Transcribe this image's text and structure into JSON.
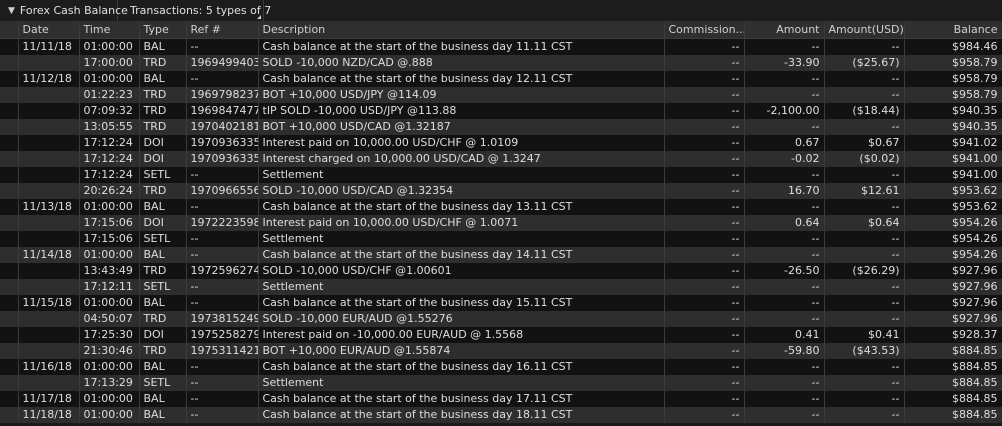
{
  "toolbar": {
    "chevron_icon": "chevron-down-icon",
    "title": "Forex Cash Balance",
    "filter_label": "Transactions: 5 types of 7"
  },
  "columns": [
    "Date",
    "Time",
    "Type",
    "Ref #",
    "Description",
    "Commission...",
    "Amount",
    "Amount(USD)",
    "Balance"
  ],
  "rows": [
    [
      "11/11/18",
      "01:00:00",
      "BAL",
      "--",
      "Cash balance at the start of the business day 11.11 CST",
      "--",
      "--",
      "--",
      "$984.46"
    ],
    [
      "",
      "17:00:00",
      "TRD",
      "1969499403",
      "SOLD -10,000 NZD/CAD @.888",
      "--",
      "-33.90",
      "($25.67)",
      "$958.79"
    ],
    [
      "11/12/18",
      "01:00:00",
      "BAL",
      "--",
      "Cash balance at the start of the business day 12.11 CST",
      "--",
      "--",
      "--",
      "$958.79"
    ],
    [
      "",
      "01:22:23",
      "TRD",
      "1969798237",
      "BOT +10,000 USD/JPY @114.09",
      "--",
      "--",
      "--",
      "$958.79"
    ],
    [
      "",
      "07:09:32",
      "TRD",
      "1969847477",
      "tIP SOLD -10,000 USD/JPY @113.88",
      "--",
      "-2,100.00",
      "($18.44)",
      "$940.35"
    ],
    [
      "",
      "13:05:55",
      "TRD",
      "1970402181",
      "BOT +10,000 USD/CAD @1.32187",
      "--",
      "--",
      "--",
      "$940.35"
    ],
    [
      "",
      "17:12:24",
      "DOI",
      "1970936335",
      "Interest paid on 10,000.00 USD/CHF @ 1.0109",
      "--",
      "0.67",
      "$0.67",
      "$941.02"
    ],
    [
      "",
      "17:12:24",
      "DOI",
      "1970936335",
      "Interest charged on 10,000.00 USD/CAD @ 1.3247",
      "--",
      "-0.02",
      "($0.02)",
      "$941.00"
    ],
    [
      "",
      "17:12:24",
      "SETL",
      "--",
      "Settlement",
      "--",
      "--",
      "--",
      "$941.00"
    ],
    [
      "",
      "20:26:24",
      "TRD",
      "1970966556",
      "SOLD -10,000 USD/CAD @1.32354",
      "--",
      "16.70",
      "$12.61",
      "$953.62"
    ],
    [
      "11/13/18",
      "01:00:00",
      "BAL",
      "--",
      "Cash balance at the start of the business day 13.11 CST",
      "--",
      "--",
      "--",
      "$953.62"
    ],
    [
      "",
      "17:15:06",
      "DOI",
      "1972223598",
      "Interest paid on 10,000.00 USD/CHF @ 1.0071",
      "--",
      "0.64",
      "$0.64",
      "$954.26"
    ],
    [
      "",
      "17:15:06",
      "SETL",
      "--",
      "Settlement",
      "--",
      "--",
      "--",
      "$954.26"
    ],
    [
      "11/14/18",
      "01:00:00",
      "BAL",
      "--",
      "Cash balance at the start of the business day 14.11 CST",
      "--",
      "--",
      "--",
      "$954.26"
    ],
    [
      "",
      "13:43:49",
      "TRD",
      "1972596274",
      "SOLD -10,000 USD/CHF @1.00601",
      "--",
      "-26.50",
      "($26.29)",
      "$927.96"
    ],
    [
      "",
      "17:12:11",
      "SETL",
      "--",
      "Settlement",
      "--",
      "--",
      "--",
      "$927.96"
    ],
    [
      "11/15/18",
      "01:00:00",
      "BAL",
      "--",
      "Cash balance at the start of the business day 15.11 CST",
      "--",
      "--",
      "--",
      "$927.96"
    ],
    [
      "",
      "04:50:07",
      "TRD",
      "1973815249",
      "SOLD -10,000 EUR/AUD @1.55276",
      "--",
      "--",
      "--",
      "$927.96"
    ],
    [
      "",
      "17:25:30",
      "DOI",
      "1975258279",
      "Interest paid on -10,000.00 EUR/AUD @ 1.5568",
      "--",
      "0.41",
      "$0.41",
      "$928.37"
    ],
    [
      "",
      "21:30:46",
      "TRD",
      "1975311421",
      "BOT +10,000 EUR/AUD @1.55874",
      "--",
      "-59.80",
      "($43.53)",
      "$884.85"
    ],
    [
      "11/16/18",
      "01:00:00",
      "BAL",
      "--",
      "Cash balance at the start of the business day 16.11 CST",
      "--",
      "--",
      "--",
      "$884.85"
    ],
    [
      "",
      "17:13:29",
      "SETL",
      "--",
      "Settlement",
      "--",
      "--",
      "--",
      "$884.85"
    ],
    [
      "11/17/18",
      "01:00:00",
      "BAL",
      "--",
      "Cash balance at the start of the business day 17.11 CST",
      "--",
      "--",
      "--",
      "$884.85"
    ],
    [
      "11/18/18",
      "01:00:00",
      "BAL",
      "--",
      "Cash balance at the start of the business day 18.11 CST",
      "--",
      "--",
      "--",
      "$884.85"
    ]
  ]
}
